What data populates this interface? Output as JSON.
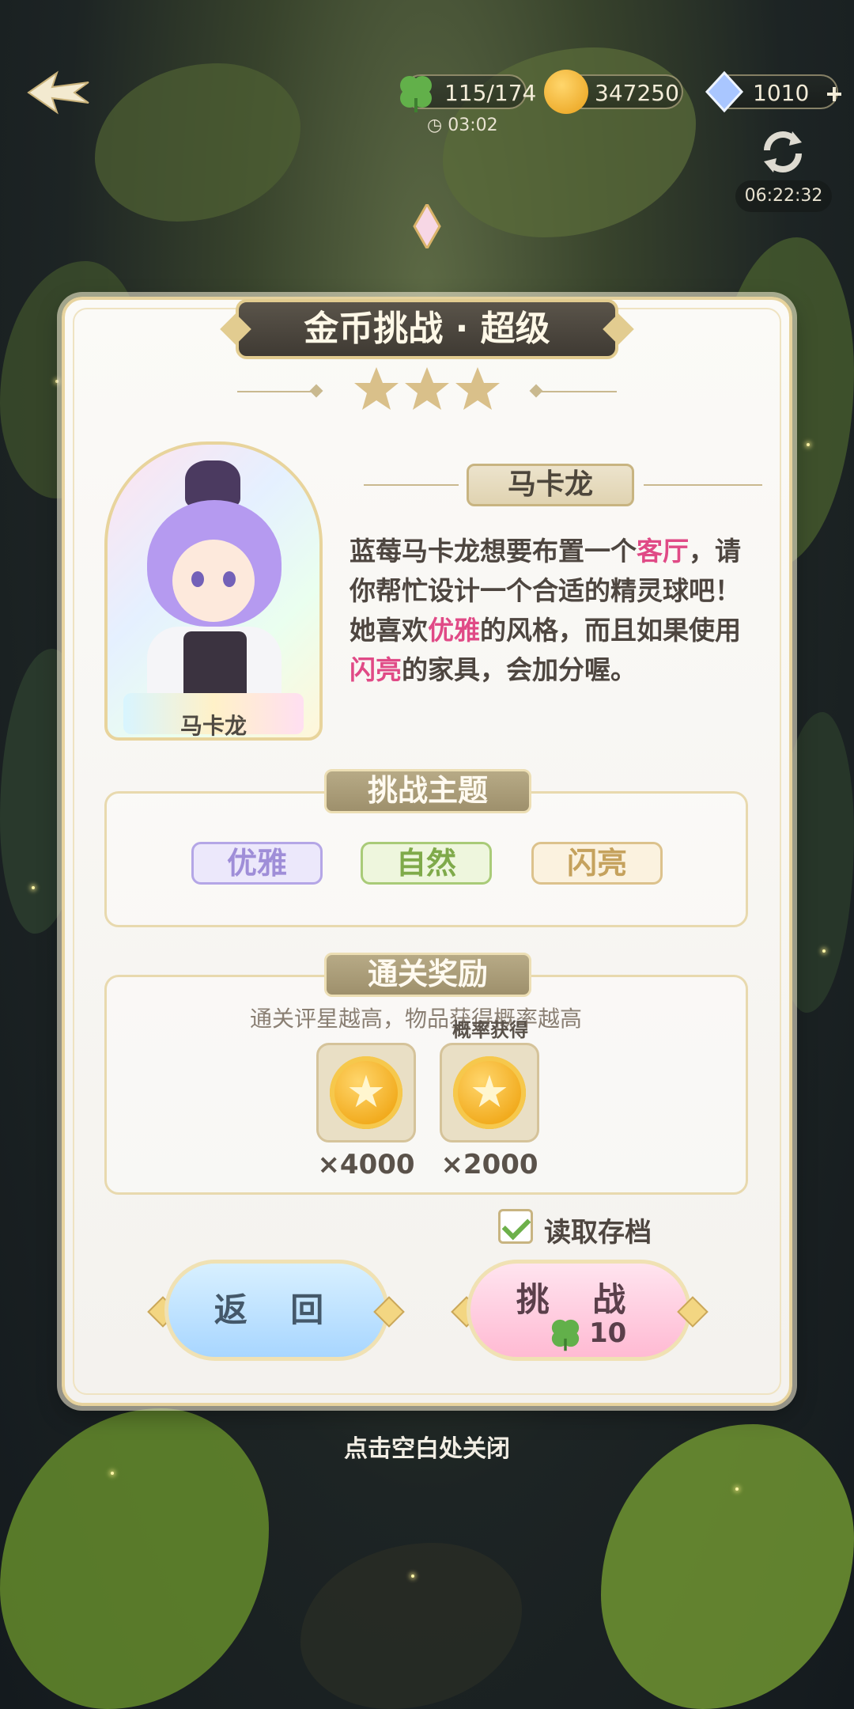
{
  "hud": {
    "stamina": "115/174",
    "stamina_timer": "03:02",
    "coins": "347250",
    "gems": "1010",
    "refresh_timer": "06:22:32"
  },
  "dialog": {
    "title": "金币挑战 · 超级",
    "stars": 3,
    "character": {
      "name": "马卡龙",
      "card_label": "马卡龙"
    },
    "description": {
      "p1": "蓝莓马卡龙想要布置一个",
      "hl1": "客厅",
      "p2": "，请你帮忙设计一个合适的精灵球吧！她喜欢",
      "hl2": "优雅",
      "p3": "的风格，而且如果使用",
      "hl3": "闪亮",
      "p4": "的家具，会加分喔。"
    },
    "theme": {
      "title": "挑战主题",
      "tags": [
        "优雅",
        "自然",
        "闪亮"
      ]
    },
    "reward": {
      "title": "通关奖励",
      "subtitle": "通关评星越高，物品获得概率越高",
      "probability_label": "概率获得",
      "items": [
        {
          "icon": "gold-coin-icon",
          "qty": "×4000"
        },
        {
          "icon": "gold-coin-icon",
          "qty": "×2000"
        }
      ]
    },
    "load_save": {
      "label": "读取存档",
      "checked": true
    },
    "buttons": {
      "back": "返 回",
      "challenge": "挑 战",
      "challenge_cost": "10"
    },
    "close_hint": "点击空白处关闭"
  },
  "colors": {
    "accent_gold": "#e7d39e",
    "highlight_pink": "#e04a86",
    "tag_elegant": "#9f8ed8",
    "tag_nature": "#7faa4a",
    "tag_shiny": "#c5a25d"
  }
}
